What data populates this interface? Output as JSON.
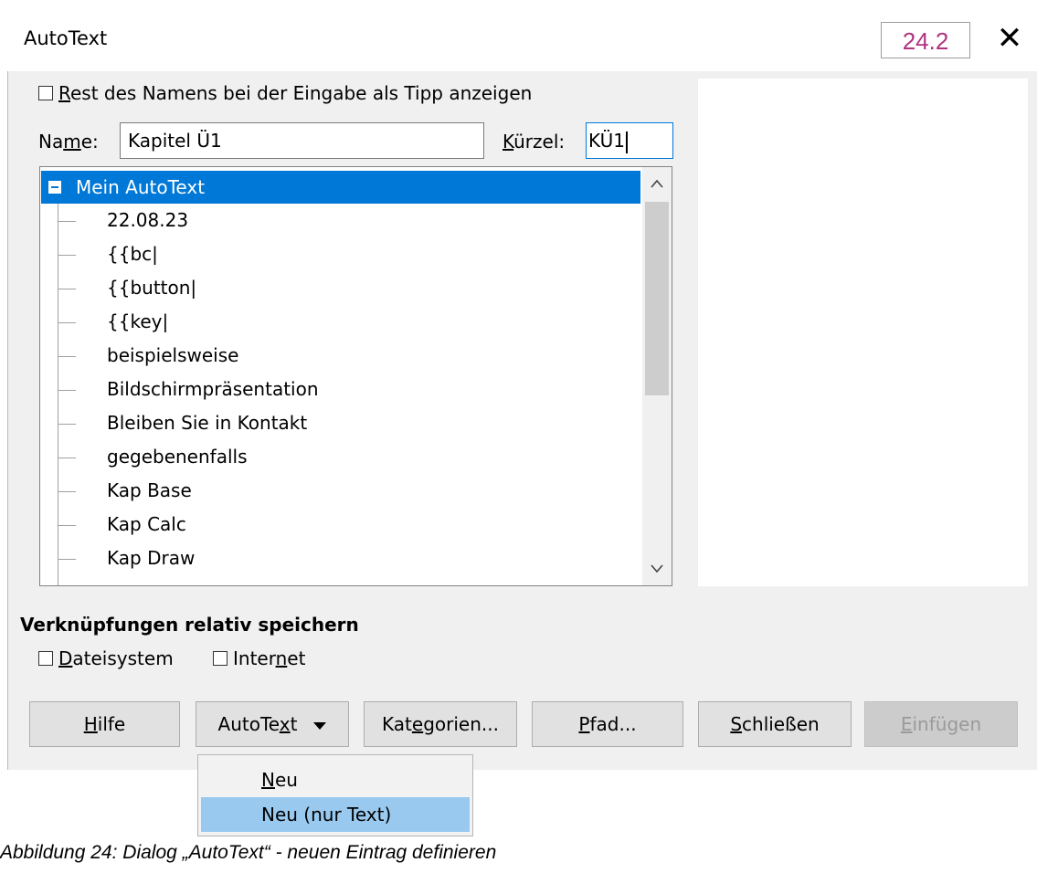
{
  "dialog": {
    "title": "AutoText",
    "version_badge": "24.2",
    "close_glyph": "✕"
  },
  "options": {
    "show_tip_label_prefix": "",
    "show_tip_label_u": "R",
    "show_tip_label_rest": "est des Namens bei der Eingabe als Tipp anzeigen",
    "show_tip_checked": false
  },
  "name_field": {
    "label_pre": "Na",
    "label_u": "m",
    "label_post": "e:",
    "value": "Kapitel Ü1"
  },
  "shortcut_field": {
    "label_u": "K",
    "label_post": "ürzel:",
    "value": "KÜ1"
  },
  "tree": {
    "root": "Mein AutoText",
    "items": [
      "22.08.23",
      "{{bc|",
      "{{button|",
      "{{key|",
      "beispielsweise",
      "Bildschirmpräsentation",
      "Bleiben Sie in Kontakt",
      "gegebenenfalls",
      "Kap Base",
      "Kap Calc",
      "Kap Draw"
    ],
    "scroll_up": "^",
    "scroll_down": "v"
  },
  "links": {
    "section_title": "Verknüpfungen relativ speichern",
    "filesystem_u": "D",
    "filesystem_rest": "ateisystem",
    "internet_pre": "Inter",
    "internet_u": "n",
    "internet_post": "et"
  },
  "buttons": {
    "help_u": "H",
    "help_rest": "ilfe",
    "autotext_pre": "AutoTe",
    "autotext_u": "x",
    "autotext_post": "t",
    "categories_pre": "Kat",
    "categories_u": "e",
    "categories_post": "gorien...",
    "path_u": "P",
    "path_rest": "fad...",
    "close_u": "S",
    "close_rest": "chließen",
    "insert_u": "E",
    "insert_rest": "infügen"
  },
  "menu": {
    "new_u": "N",
    "new_rest": "eu",
    "new_text_only": "Neu (nur Text)"
  },
  "caption": "Abbildung 24: Dialog „AutoText“ - neuen Eintrag definieren"
}
